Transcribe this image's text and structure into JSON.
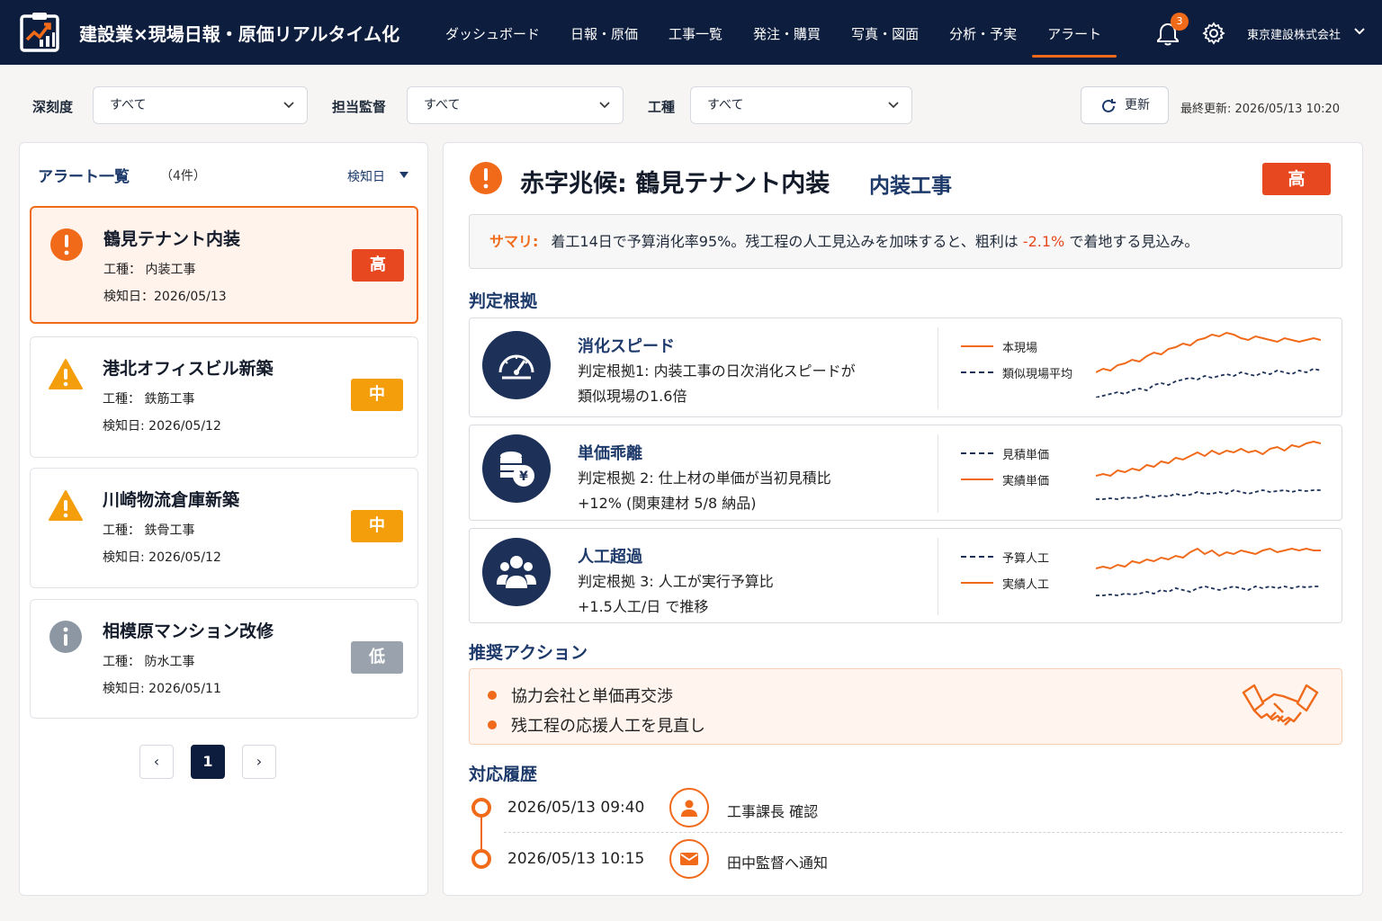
{
  "app": {
    "title": "建設業×現場日報・原価リアルタイム化",
    "company": "東京建設株式会社",
    "notification_count": "3"
  },
  "nav": [
    {
      "label": "ダッシュボード",
      "active": false
    },
    {
      "label": "日報・原価",
      "active": false
    },
    {
      "label": "工事一覧",
      "active": false
    },
    {
      "label": "発注・購買",
      "active": false
    },
    {
      "label": "写真・図面",
      "active": false
    },
    {
      "label": "分析・予実",
      "active": false
    },
    {
      "label": "アラート",
      "active": true
    }
  ],
  "filters": {
    "severity_label": "深刻度",
    "severity_value": "すべて",
    "supervisor_label": "担当監督",
    "supervisor_value": "すべて",
    "trade_label": "工種",
    "trade_value": "すべて",
    "refresh_label": "更新",
    "last_updated": "最終更新: 2026/05/13 10:20"
  },
  "alert_list": {
    "title": "アラート一覧",
    "count": "（4件）",
    "sort_label": "検知日",
    "items": [
      {
        "name": "鶴見テナント内装",
        "trade": "工種：  内装工事",
        "detected": "検知日：2026/05/13",
        "severity": "高",
        "level": "high",
        "icon": "error-icon"
      },
      {
        "name": "港北オフィスビル新築",
        "trade": "工種：  鉄筋工事",
        "detected": "検知日: 2026/05/12",
        "severity": "中",
        "level": "medium",
        "icon": "warning-icon"
      },
      {
        "name": "川崎物流倉庫新築",
        "trade": "工種：  鉄骨工事",
        "detected": "検知日: 2026/05/12",
        "severity": "中",
        "level": "medium",
        "icon": "warning-icon"
      },
      {
        "name": "相模原マンション改修",
        "trade": "工種：  防水工事",
        "detected": "検知日: 2026/05/11",
        "severity": "低",
        "level": "low",
        "icon": "info-icon"
      }
    ],
    "pagination": {
      "prev": "‹",
      "current": "1",
      "next": "›"
    }
  },
  "detail": {
    "title": "赤字兆候: 鶴見テナント内装",
    "category": "内装工事",
    "severity": "高",
    "summary_label": "サマリ:",
    "summary_pre": "着工14日で予算消化率95%。残工程の人工見込みを加味すると、粗利は",
    "summary_highlight": "-2.1%",
    "summary_post": "で着地する見込み。",
    "rationale_heading": "判定根拠",
    "rationale": [
      {
        "title": "消化スピード",
        "line1": "判定根拠1: 内装工事の日次消化スピードが",
        "line2": "類似現場の1.6倍",
        "legend1": "本現場",
        "legend2": "類似現場平均",
        "icon": "speedometer-icon"
      },
      {
        "title": "単価乖離",
        "line1": "判定根拠 2: 仕上材の単価が当初見積比",
        "line2": "+12% (関東建材 5/8 納品)",
        "legend1": "見積単価",
        "legend2": "実績単価",
        "icon": "yen-coins-icon"
      },
      {
        "title": "人工超過",
        "line1": "判定根拠 3: 人工が実行予算比",
        "line2": "+1.5人工/日 で推移",
        "legend1": "予算人工",
        "legend2": "実績人工",
        "icon": "people-icon"
      }
    ],
    "actions_heading": "推奨アクション",
    "actions": [
      "協力会社と単価再交渉",
      "残工程の応援人工を見直し"
    ],
    "history_heading": "対応履歴",
    "history": [
      {
        "time": "2026/05/13  09:40",
        "text": "工事課長 確認",
        "icon": "user-icon"
      },
      {
        "time": "2026/05/13  10:15",
        "text": "田中監督へ通知",
        "icon": "mail-icon"
      }
    ]
  },
  "colors": {
    "accent": "#f06a1a",
    "navy": "#0d1d3d",
    "high": "#e8481f",
    "medium": "#f59e0b",
    "low": "#9aa3ad"
  }
}
